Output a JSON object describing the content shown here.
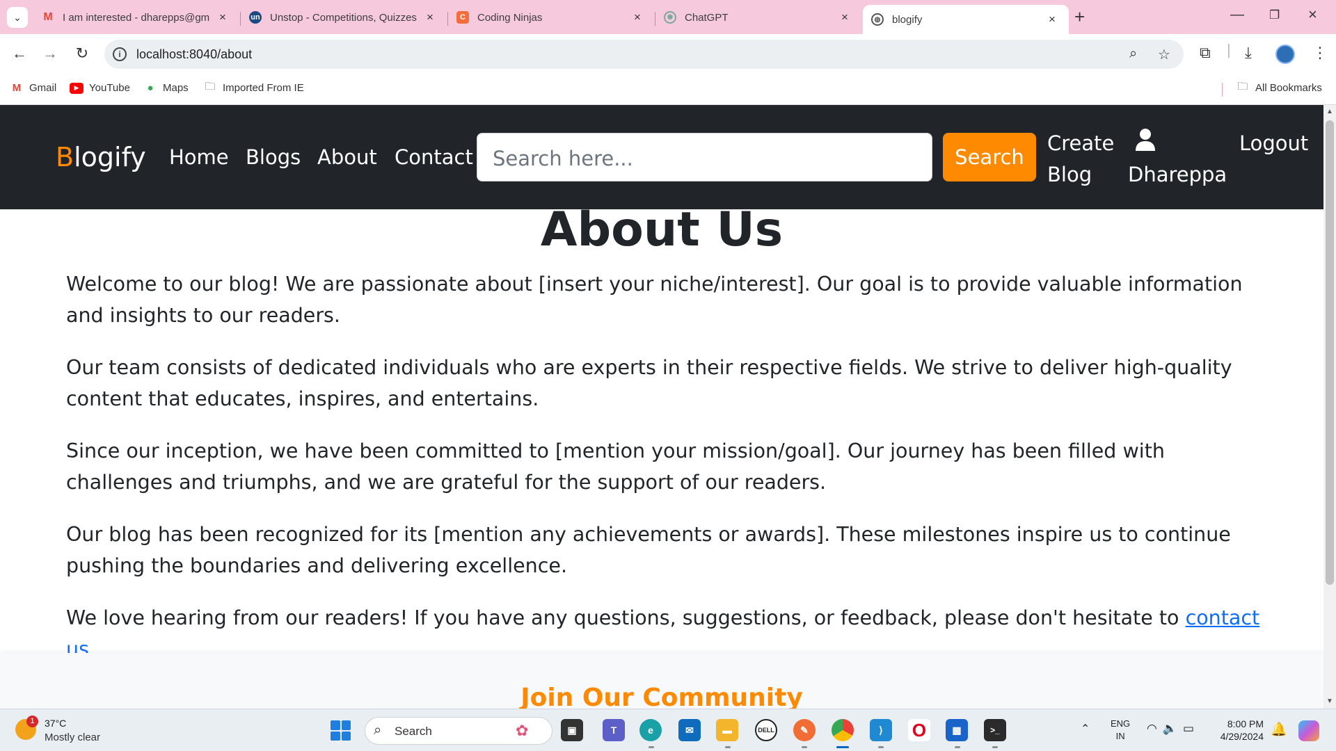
{
  "browser": {
    "tabs": [
      {
        "title": "I am interested - dharepps@gm",
        "icon": "gmail-icon",
        "active": false
      },
      {
        "title": "Unstop - Competitions, Quizzes",
        "icon": "unstop-icon",
        "active": false
      },
      {
        "title": "Coding Ninjas",
        "icon": "coding-ninjas-icon",
        "active": false
      },
      {
        "title": "ChatGPT",
        "icon": "chatgpt-icon",
        "active": false
      },
      {
        "title": "blogify",
        "icon": "globe-icon",
        "active": true
      }
    ],
    "new_tab": "+",
    "url": "localhost:8040/about",
    "bookmarks": [
      {
        "label": "Gmail",
        "icon": "gmail-icon"
      },
      {
        "label": "YouTube",
        "icon": "youtube-icon"
      },
      {
        "label": "Maps",
        "icon": "maps-pin-icon"
      },
      {
        "label": "Imported From IE",
        "icon": "folder-icon"
      }
    ],
    "all_bookmarks": "All Bookmarks"
  },
  "site": {
    "brand_first": "B",
    "brand_rest": "logify",
    "nav": [
      "Home",
      "Blogs",
      "About",
      "Contact"
    ],
    "search_placeholder": "Search here...",
    "search_button": "Search",
    "create_blog_line1": "Create",
    "create_blog_line2": "Blog",
    "user_name": "Dhareppa",
    "logout": "Logout",
    "accent_color": "#fd8a00",
    "nav_bg": "#212529"
  },
  "about": {
    "title": "About Us",
    "paragraphs": [
      "Welcome to our blog! We are passionate about [insert your niche/interest]. Our goal is to provide valuable information and insights to our readers.",
      "Our team consists of dedicated individuals who are experts in their respective fields. We strive to deliver high-quality content that educates, inspires, and entertains.",
      "Since our inception, we have been committed to [mention your mission/goal]. Our journey has been filled with challenges and triumphs, and we are grateful for the support of our readers.",
      "Our blog has been recognized for its [mention any achievements or awards]. These milestones inspire us to continue pushing the boundaries and delivering excellence."
    ],
    "last_paragraph_prefix": "We love hearing from our readers! If you have any questions, suggestions, or feedback, please don't hesitate to ",
    "contact_link": "contact us",
    "last_paragraph_suffix": "."
  },
  "community": {
    "title": "Join Our Community"
  },
  "taskbar": {
    "weather_badge": "1",
    "weather_temp": "37°C",
    "weather_desc": "Mostly clear",
    "search_label": "Search",
    "lang_line1": "ENG",
    "lang_line2": "IN",
    "time": "8:00 PM",
    "date": "4/29/2024"
  }
}
